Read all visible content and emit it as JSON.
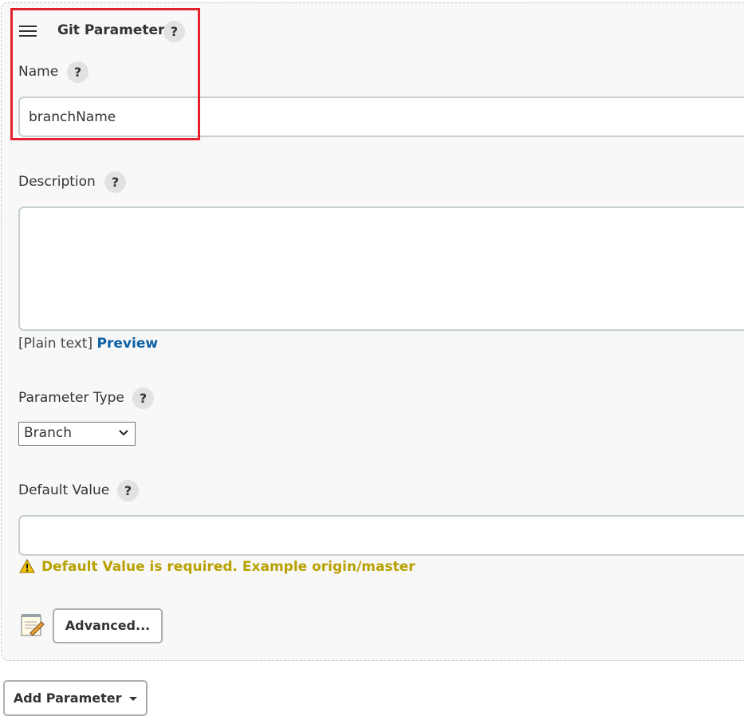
{
  "header": {
    "title": "Git Parameter",
    "help": "?"
  },
  "name": {
    "label": "Name",
    "help": "?",
    "value": "branchName"
  },
  "description": {
    "label": "Description",
    "help": "?",
    "value": "",
    "format_label": "[Plain text]",
    "preview_link": "Preview"
  },
  "parameter_type": {
    "label": "Parameter Type",
    "help": "?",
    "selected": "Branch"
  },
  "default_value": {
    "label": "Default Value",
    "help": "?",
    "value": "",
    "warning": "Default Value is required. Example origin/master"
  },
  "advanced_button": "Advanced...",
  "add_parameter_button": "Add Parameter",
  "colors": {
    "highlight": "#e3202d",
    "link": "#0b5fa5",
    "warning": "#b8a100"
  },
  "icons": {
    "drag": "hamburger-icon",
    "warning": "warning-icon",
    "notepad": "notepad-icon",
    "dropdown": "chevron-down-icon"
  }
}
